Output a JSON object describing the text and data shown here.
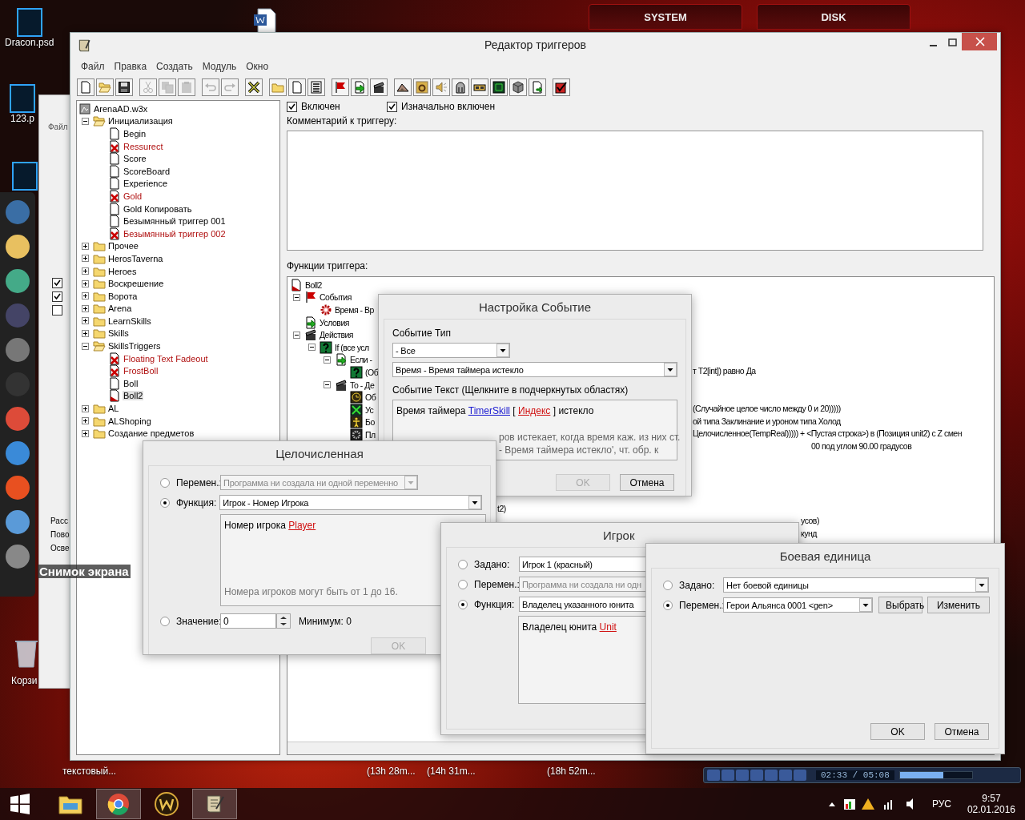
{
  "desktop": {
    "icons": [
      {
        "label": "Dracon.psd"
      },
      {
        "label": "123.p"
      }
    ],
    "screenshot_label": "Снимок экрана",
    "recycle_label": "Корзи",
    "bottom_labels": [
      "текстовый...",
      "(13h 28m...",
      "(14h 31m...",
      "(18h 52m..."
    ],
    "widget_tabs": [
      "SYSTEM",
      "DISK"
    ]
  },
  "back_window": {
    "menu": "Файл",
    "checks": [
      {
        "checked": true
      },
      {
        "checked": true
      },
      {
        "checked": false
      }
    ],
    "labels": [
      "Расс",
      "Пово",
      "Осве"
    ]
  },
  "window": {
    "title": "Редактор триггеров",
    "menu": [
      "Файл",
      "Правка",
      "Создать",
      "Модуль",
      "Окно"
    ],
    "toolbar": [
      [
        {
          "kind": "new",
          "disabled": false
        },
        {
          "kind": "open",
          "disabled": false
        },
        {
          "kind": "save",
          "disabled": false
        }
      ],
      [
        {
          "kind": "cut",
          "disabled": true
        },
        {
          "kind": "copy",
          "disabled": true
        },
        {
          "kind": "paste",
          "disabled": true
        }
      ],
      [
        {
          "kind": "undo",
          "disabled": true
        },
        {
          "kind": "redo",
          "disabled": true
        }
      ],
      [
        {
          "kind": "delete",
          "disabled": false
        }
      ],
      [
        {
          "kind": "folder",
          "disabled": false
        },
        {
          "kind": "page",
          "disabled": false
        },
        {
          "kind": "list",
          "disabled": false
        }
      ],
      [
        {
          "kind": "flag",
          "disabled": false
        },
        {
          "kind": "arrow",
          "disabled": false
        },
        {
          "kind": "clapper",
          "disabled": false
        }
      ],
      [
        {
          "kind": "terrain",
          "disabled": false
        },
        {
          "kind": "badge",
          "disabled": false
        },
        {
          "kind": "sound",
          "disabled": false
        },
        {
          "kind": "helmet",
          "disabled": false
        },
        {
          "kind": "panel",
          "disabled": false
        },
        {
          "kind": "grid",
          "disabled": false
        },
        {
          "kind": "cube",
          "disabled": false
        },
        {
          "kind": "export",
          "disabled": false
        }
      ],
      [
        {
          "kind": "check",
          "disabled": false
        }
      ]
    ],
    "tree": {
      "label": "ArenaAD.w3x",
      "kind": "map",
      "children": [
        {
          "label": "Инициализация",
          "kind": "folder",
          "expanded": true,
          "children": [
            {
              "label": "Begin",
              "kind": "trigger",
              "disabled": false,
              "selected": false
            },
            {
              "label": "Ressurect",
              "kind": "trigger",
              "disabled": true,
              "selected": false
            },
            {
              "label": "Score",
              "kind": "trigger",
              "disabled": false,
              "selected": false
            },
            {
              "label": "ScoreBoard",
              "kind": "trigger",
              "disabled": false,
              "selected": false
            },
            {
              "label": "Experience",
              "kind": "trigger",
              "disabled": false,
              "selected": false
            },
            {
              "label": "Gold",
              "kind": "trigger",
              "disabled": true,
              "selected": false
            },
            {
              "label": "Gold Копировать",
              "kind": "trigger",
              "disabled": false,
              "selected": false
            },
            {
              "label": "Безымянный триггер 001",
              "kind": "trigger",
              "disabled": false,
              "selected": false
            },
            {
              "label": "Безымянный триггер 002",
              "kind": "trigger",
              "disabled": true,
              "selected": false
            }
          ]
        },
        {
          "label": "Прочее",
          "kind": "folder",
          "expanded": false
        },
        {
          "label": "HerosTaverna",
          "kind": "folder",
          "expanded": false
        },
        {
          "label": "Heroes",
          "kind": "folder",
          "expanded": false
        },
        {
          "label": "Воскрешение",
          "kind": "folder",
          "expanded": false
        },
        {
          "label": "Ворота",
          "kind": "folder",
          "expanded": false
        },
        {
          "label": "Arena",
          "kind": "folder",
          "expanded": false
        },
        {
          "label": "LearnSkills",
          "kind": "folder",
          "expanded": false
        },
        {
          "label": "Skills",
          "kind": "folder",
          "expanded": false
        },
        {
          "label": "SkillsTriggers",
          "kind": "folder",
          "expanded": true,
          "children": [
            {
              "label": "Floating Text Fadeout",
              "kind": "trigger",
              "disabled": true,
              "selected": false
            },
            {
              "label": "FrostBoll",
              "kind": "trigger",
              "disabled": true,
              "selected": false
            },
            {
              "label": "Boll",
              "kind": "trigger",
              "disabled": false,
              "selected": false
            },
            {
              "label": "Boll2",
              "kind": "custom",
              "disabled": false,
              "selected": true
            }
          ]
        },
        {
          "label": "AL",
          "kind": "folder",
          "expanded": false
        },
        {
          "label": "ALShoping",
          "kind": "folder",
          "expanded": false
        },
        {
          "label": "Создание предметов",
          "kind": "folder",
          "expanded": false
        }
      ]
    },
    "enabled": {
      "label": "Включен",
      "checked": true
    },
    "initially_on": {
      "label": "Изначально включен",
      "checked": true
    },
    "comment_label": "Комментарий к триггеру:",
    "functions_label": "Функции триггера:",
    "functions": {
      "label": "Boll2",
      "kind": "custom",
      "children": [
        {
          "label": "События",
          "kind": "flag",
          "expanded": true,
          "children": [
            {
              "label": "Время - Вр",
              "kind": "gear"
            }
          ]
        },
        {
          "label": "Условия",
          "kind": "arrow"
        },
        {
          "label": "Действия",
          "kind": "clapper",
          "expanded": true,
          "children": [
            {
              "label": "If (все усл",
              "kind": "question",
              "expanded": true,
              "children": [
                {
                  "label": "Если -",
                  "kind": "arrow",
                  "expanded": true,
                  "children": [
                    {
                      "label": "(Об",
                      "kind": "question"
                    }
                  ]
                },
                {
                  "label": "То - Де",
                  "kind": "clapper",
                  "expanded": true,
                  "children": [
                    {
                      "label": "Об",
                      "kind": "clock"
                    },
                    {
                      "label": "Ус",
                      "kind": "xvar"
                    },
                    {
                      "label": "Бо",
                      "kind": "figure"
                    },
                    {
                      "label": "Пл",
                      "kind": "cog"
                    }
                  ]
                }
              ]
            }
          ]
        }
      ]
    },
    "clipped_lines": [
      {
        "text": "т T2[int]) равно Да"
      },
      {
        "text": "(Случайное целое число между 0 и 20)))))"
      },
      {
        "text": "ой типа Заклинание и уроном типа Холод"
      },
      {
        "text": "Целочисленное(TempReal))))) + <Пустая строка>) в (Позиция unit2) с Z смен"
      },
      {
        "text": "00 под углом 90.00 градусов"
      },
      {
        "text": "t2)"
      },
      {
        "text": "усов)"
      },
      {
        "text": "кунд"
      }
    ]
  },
  "event_dialog": {
    "title": "Настройка Событие",
    "type_label": "Событие Тип",
    "type_value": "- Все",
    "event_value": "Время - Время таймера истекло",
    "text_label": "Событие Текст (Щелкните в подчеркнутых областях)",
    "parts": [
      {
        "text": "Время таймера",
        "kind": "plain"
      },
      {
        "text": "TimerSkill",
        "kind": "set"
      },
      {
        "text": "[",
        "kind": "plain"
      },
      {
        "text": "Индекс",
        "kind": "unset"
      },
      {
        "text": "]",
        "kind": "plain"
      },
      {
        "text": "истекло",
        "kind": "plain"
      }
    ],
    "description": [
      "ров истекает, когда время каж. из них ст.",
      "- Время таймера истекло', чт. обр. к"
    ],
    "buttons": [
      {
        "label": "OK",
        "disabled": true
      },
      {
        "label": "Отмена",
        "disabled": false
      }
    ]
  },
  "int_dialog": {
    "title": "Целочисленная",
    "options": [
      {
        "label": "Перемен.:",
        "selected": false,
        "value": "Программа ни создала ни одной переменно",
        "disabled": true
      },
      {
        "label": "Функция:",
        "selected": true,
        "value": "Игрок - Номер Игрока",
        "disabled": false
      }
    ],
    "parts": [
      {
        "text": "Номер игрока",
        "kind": "plain"
      },
      {
        "text": "Player",
        "kind": "unset"
      }
    ],
    "hint": "Номера игроков могут быть от 1 до 16.",
    "value_option": {
      "label": "Значение:",
      "selected": false,
      "value": "0",
      "min_label": "Минимум: 0"
    },
    "buttons": [
      {
        "label": "OK",
        "disabled": true
      }
    ]
  },
  "player_dialog": {
    "title": "Игрок",
    "options": [
      {
        "label": "Задано:",
        "selected": false,
        "value": "Игрок 1 (красный)",
        "disabled": false
      },
      {
        "label": "Перемен.:",
        "selected": false,
        "value": "Программа ни создала ни одн",
        "disabled": true
      },
      {
        "label": "Функция:",
        "selected": true,
        "value": "Владелец указанного юнита",
        "disabled": false
      }
    ],
    "parts": [
      {
        "text": "Владелец юнита",
        "kind": "plain"
      },
      {
        "text": "Unit",
        "kind": "unset"
      }
    ]
  },
  "unit_dialog": {
    "title": "Боевая единица",
    "options": [
      {
        "label": "Задано:",
        "selected": false,
        "value": "Нет боевой единицы"
      },
      {
        "label": "Перемен.:",
        "selected": true,
        "value": "Герои Альянса 0001 <gen>"
      }
    ],
    "side_buttons": [
      {
        "label": "Выбрать"
      },
      {
        "label": "Изменить"
      }
    ],
    "buttons": [
      {
        "label": "OK",
        "disabled": false
      },
      {
        "label": "Отмена",
        "disabled": false
      }
    ]
  },
  "media_player": {
    "time": "02:33 / 05:08",
    "level": 0.6
  },
  "taskbar": {
    "apps": [
      {
        "kind": "explorer",
        "active": false
      },
      {
        "kind": "chrome",
        "active": true
      },
      {
        "kind": "wow",
        "active": false
      },
      {
        "kind": "editor",
        "active": true
      }
    ],
    "language": "РУС",
    "time": "9:57",
    "date": "02.01.2016"
  }
}
